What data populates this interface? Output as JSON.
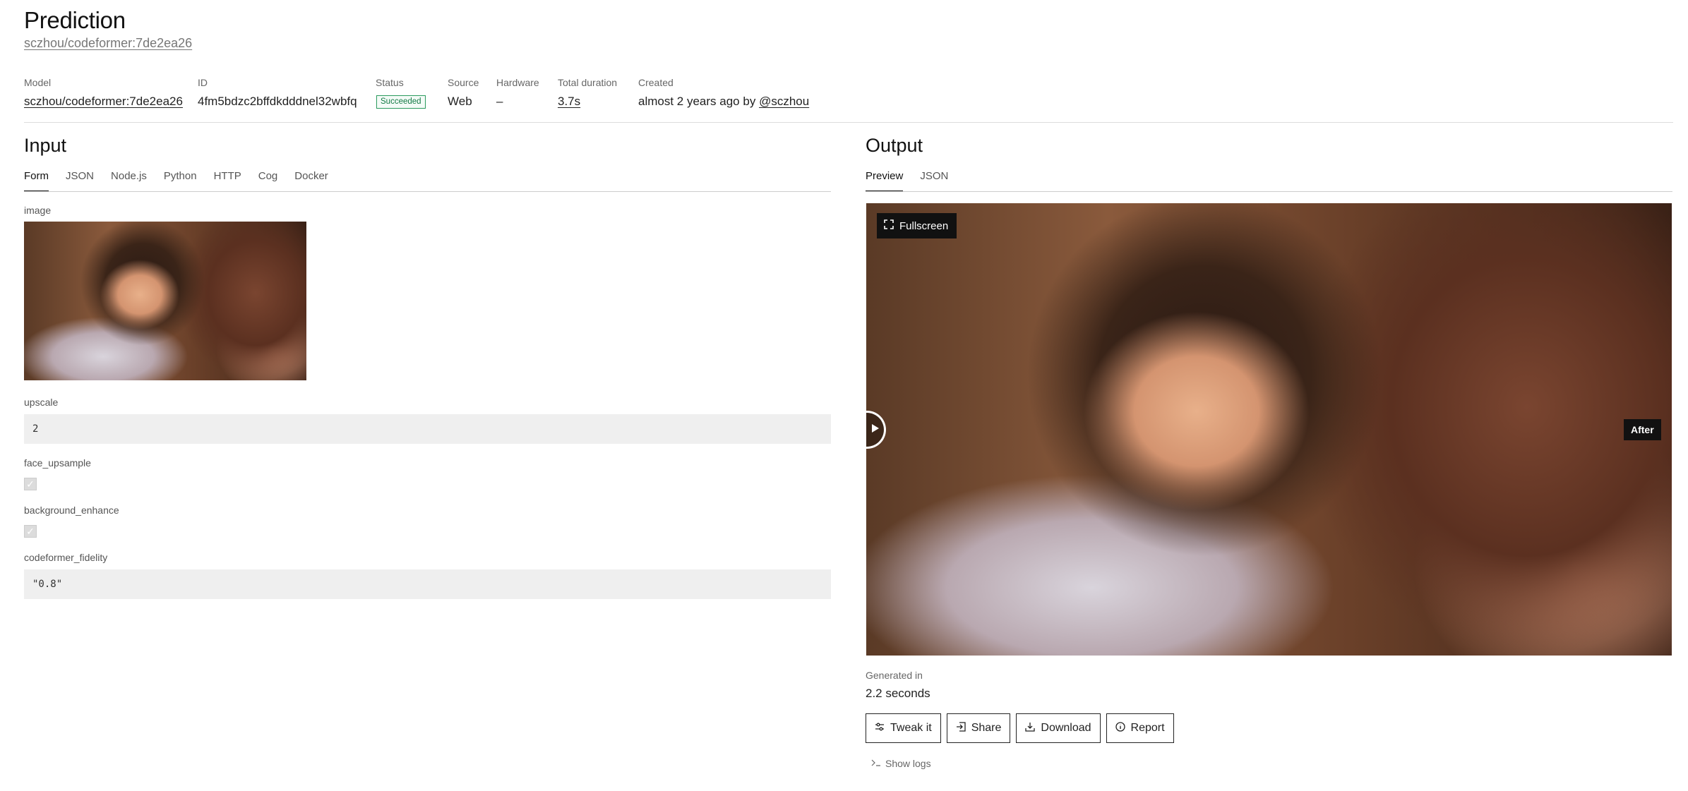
{
  "header": {
    "title": "Prediction",
    "version_link": "sczhou/codeformer:7de2ea26"
  },
  "meta": {
    "model": {
      "label": "Model",
      "value": "sczhou/codeformer:7de2ea26"
    },
    "id": {
      "label": "ID",
      "value": "4fm5bdzc2bffdkdddnel32wbfq"
    },
    "status": {
      "label": "Status",
      "value": "Succeeded",
      "color": "#2a9a5d"
    },
    "source": {
      "label": "Source",
      "value": "Web"
    },
    "hardware": {
      "label": "Hardware",
      "value": "–"
    },
    "duration": {
      "label": "Total duration",
      "value": "3.7s"
    },
    "created": {
      "label": "Created",
      "value": "almost 2 years ago",
      "by": "by",
      "user": "@sczhou"
    }
  },
  "input": {
    "title": "Input",
    "tabs": [
      "Form",
      "JSON",
      "Node.js",
      "Python",
      "HTTP",
      "Cog",
      "Docker"
    ],
    "active_tab": "Form",
    "fields": {
      "image": {
        "label": "image"
      },
      "upscale": {
        "label": "upscale",
        "value": "2"
      },
      "face_upsample": {
        "label": "face_upsample",
        "checked": true
      },
      "background_enhance": {
        "label": "background_enhance",
        "checked": true
      },
      "codeformer_fidelity": {
        "label": "codeformer_fidelity",
        "value": "\"0.8\""
      }
    }
  },
  "output": {
    "title": "Output",
    "tabs": [
      "Preview",
      "JSON"
    ],
    "active_tab": "Preview",
    "fullscreen_label": "Fullscreen",
    "after_label": "After",
    "generated_label": "Generated in",
    "generated_value": "2.2 seconds",
    "buttons": {
      "tweak": "Tweak it",
      "share": "Share",
      "download": "Download",
      "report": "Report"
    },
    "show_logs": "Show logs"
  },
  "icons": {
    "fullscreen": "expand-icon",
    "tweak": "sliders-icon",
    "share": "share-icon",
    "download": "download-icon",
    "report": "info-circle-icon",
    "logs": "terminal-icon",
    "slider": "play-triangle-icon"
  }
}
